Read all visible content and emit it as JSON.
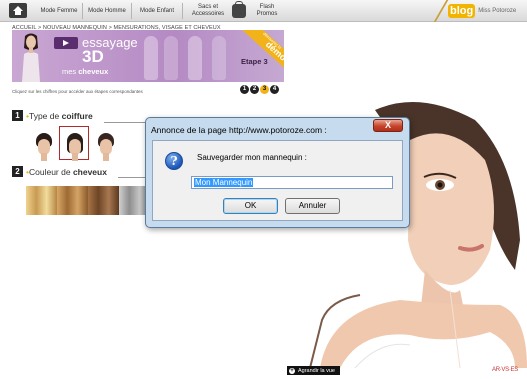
{
  "nav": {
    "items": [
      "Mode Femme",
      "Mode Homme",
      "Mode Enfant",
      "Sacs et Accessoires",
      "Flash Promos"
    ],
    "blog_label": "blog",
    "blog_sub": "Miss Potoroze"
  },
  "breadcrumb": "ACCUEIL > NOUVEAU MANNEQUIN > MENSURATIONS, VISAGE ET CHEVEUX",
  "banner": {
    "line1": "essayage",
    "line2": "3D",
    "line3_prefix": "mes ",
    "line3_bold": "cheveux",
    "step_label": "Etape 3",
    "ribbon": "démo",
    "ribbon_small": "découvrez la"
  },
  "instruction": "Cliquez sur les chiffres pour accéder aux étapes correspondantes",
  "steps": [
    "1",
    "2",
    "3",
    "4"
  ],
  "section1": {
    "number": "1",
    "title_plain": "Type de ",
    "title_bold": "coiffure"
  },
  "section2": {
    "number": "2",
    "title_plain": "Couleur de ",
    "title_bold": "cheveux"
  },
  "hair_colors": [
    "#d9b36a",
    "#c08a4a",
    "#8a5a32",
    "#b7b7b7"
  ],
  "dialog": {
    "title": "Annonce de la page http://www.potoroze.com :",
    "close_label": "X",
    "message": "Sauvegarder mon mannequin :",
    "input_value": "Mon Mannequin",
    "ok_label": "OK",
    "cancel_label": "Annuler"
  },
  "enlarge_label": "Agrandir la vue",
  "footer_logo": "AR·VS·ES"
}
